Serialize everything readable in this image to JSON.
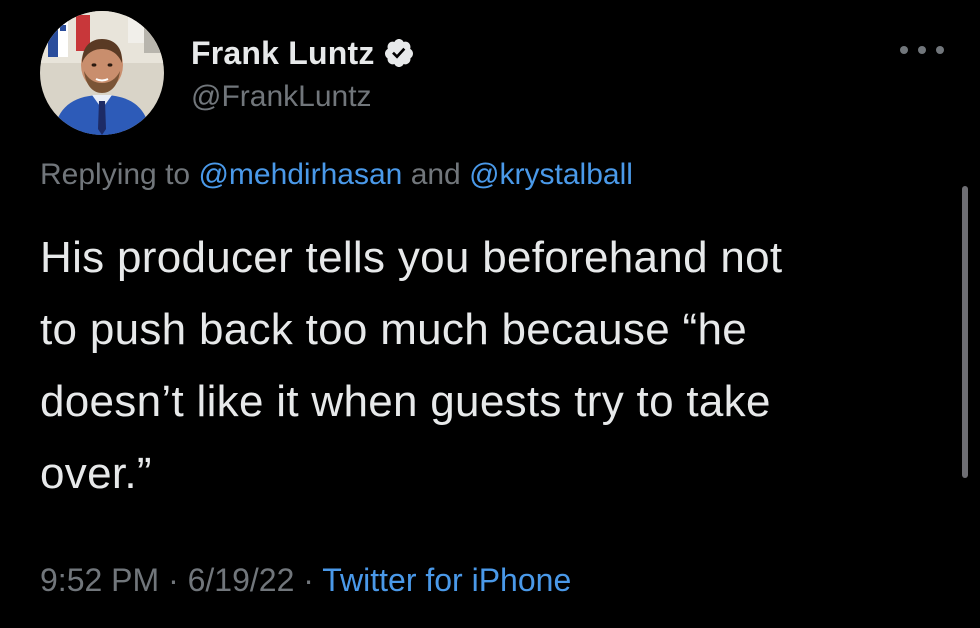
{
  "author": {
    "name": "Frank Luntz",
    "handle": "@FrankLuntz",
    "verified": true
  },
  "icons": {
    "verified": "verified-badge-icon",
    "more": "more-horizontal-icon"
  },
  "reply": {
    "prefix": "Replying to",
    "mention1": "@mehdirhasan",
    "joiner": "and",
    "mention2": "@krystalball"
  },
  "tweet": {
    "lines": [
      "His producer tells you beforehand not",
      "to push back too much because “he",
      "doesn’t like it when guests try to take",
      "over.”"
    ]
  },
  "meta": {
    "time": "9:52 PM",
    "separator1": "·",
    "date": "6/19/22",
    "separator2": "·",
    "source": "Twitter for iPhone"
  },
  "colors": {
    "background": "#000000",
    "primary_text": "#e7e9ea",
    "secondary_text": "#71767b",
    "link": "#4a99e9"
  }
}
